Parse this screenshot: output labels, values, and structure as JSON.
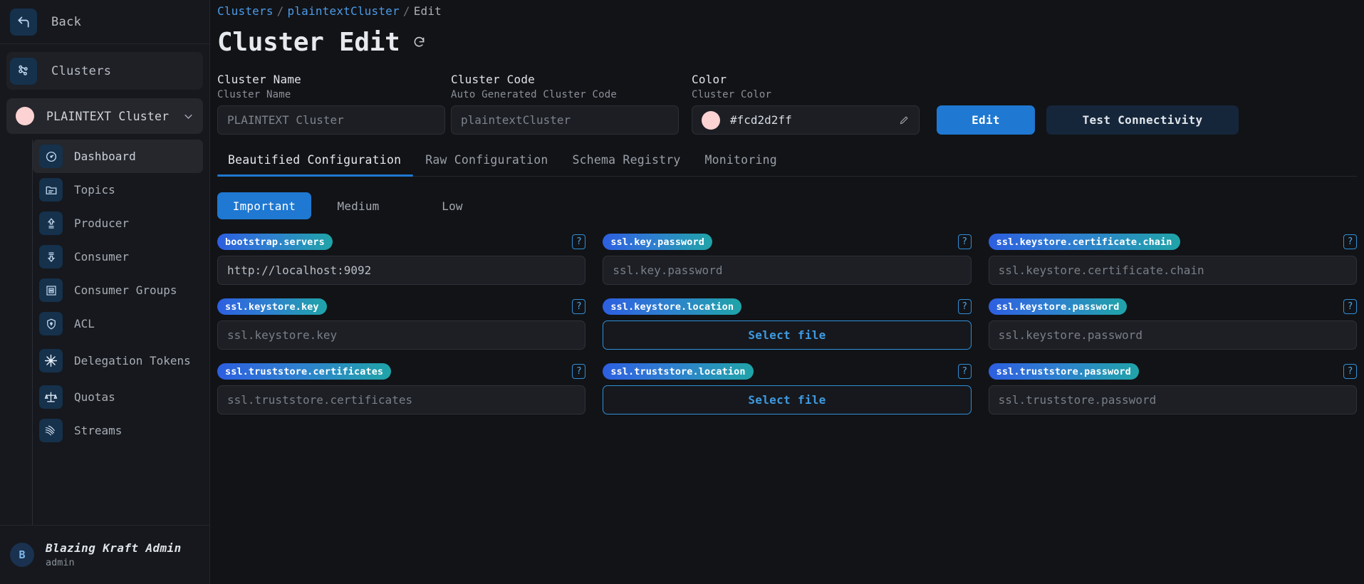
{
  "sidebar": {
    "back_label": "Back",
    "clusters_label": "Clusters",
    "selected_cluster": "PLAINTEXT Cluster",
    "selected_cluster_color": "#fcd2d2",
    "nav": [
      {
        "label": "Dashboard",
        "icon": "gauge-icon",
        "active": true
      },
      {
        "label": "Topics",
        "icon": "folder-icon",
        "active": false
      },
      {
        "label": "Producer",
        "icon": "upload-arrow-icon",
        "active": false
      },
      {
        "label": "Consumer",
        "icon": "download-arrow-icon",
        "active": false
      },
      {
        "label": "Consumer Groups",
        "icon": "group-list-icon",
        "active": false
      },
      {
        "label": "ACL",
        "icon": "shield-lock-icon",
        "active": false
      },
      {
        "label": "Delegation Tokens",
        "icon": "snowflake-icon",
        "active": false
      },
      {
        "label": "Quotas",
        "icon": "scales-icon",
        "active": false
      },
      {
        "label": "Streams",
        "icon": "streams-icon",
        "active": false
      }
    ],
    "user": {
      "initial": "B",
      "name": "Blazing Kraft Admin",
      "role": "admin"
    }
  },
  "breadcrumb": {
    "root": "Clusters",
    "cluster": "plaintextCluster",
    "current": "Edit",
    "separator": "/"
  },
  "header": {
    "title": "Cluster Edit",
    "refresh_icon": "refresh-icon"
  },
  "form": {
    "cluster_name": {
      "title": "Cluster Name",
      "subtitle": "Cluster Name",
      "placeholder": "PLAINTEXT Cluster",
      "value": ""
    },
    "cluster_code": {
      "title": "Cluster Code",
      "subtitle": "Auto Generated Cluster Code",
      "placeholder": "plaintextCluster",
      "value": ""
    },
    "color": {
      "title": "Color",
      "subtitle": "Cluster Color",
      "value": "#fcd2d2ff",
      "swatch": "#fcd2d2",
      "edit_icon": "pencil-icon"
    },
    "edit_button": "Edit",
    "test_button": "Test Connectivity"
  },
  "tabs": [
    {
      "label": "Beautified Configuration",
      "active": true
    },
    {
      "label": "Raw Configuration",
      "active": false
    },
    {
      "label": "Schema Registry",
      "active": false
    },
    {
      "label": "Monitoring",
      "active": false
    }
  ],
  "importance_filters": [
    {
      "label": "Important",
      "active": true
    },
    {
      "label": "Medium",
      "active": false
    },
    {
      "label": "Low",
      "active": false
    }
  ],
  "config_fields": [
    {
      "name": "bootstrap.servers",
      "kind": "text",
      "value": "http://localhost:9092",
      "placeholder": "",
      "help": "?"
    },
    {
      "name": "ssl.key.password",
      "kind": "text",
      "value": "",
      "placeholder": "ssl.key.password",
      "help": "?"
    },
    {
      "name": "ssl.keystore.certificate.chain",
      "kind": "text",
      "value": "",
      "placeholder": "ssl.keystore.certificate.chain",
      "help": "?"
    },
    {
      "name": "ssl.keystore.key",
      "kind": "text",
      "value": "",
      "placeholder": "ssl.keystore.key",
      "help": "?"
    },
    {
      "name": "ssl.keystore.location",
      "kind": "file",
      "value": "",
      "placeholder": "Select file",
      "help": "?"
    },
    {
      "name": "ssl.keystore.password",
      "kind": "text",
      "value": "",
      "placeholder": "ssl.keystore.password",
      "help": "?"
    },
    {
      "name": "ssl.truststore.certificates",
      "kind": "text",
      "value": "",
      "placeholder": "ssl.truststore.certificates",
      "help": "?"
    },
    {
      "name": "ssl.truststore.location",
      "kind": "file",
      "value": "",
      "placeholder": "Select file",
      "help": "?"
    },
    {
      "name": "ssl.truststore.password",
      "kind": "text",
      "value": "",
      "placeholder": "ssl.truststore.password",
      "help": "?"
    }
  ],
  "colors": {
    "accent": "#1f78d1",
    "link": "#4c9be8",
    "badge_start": "#2d5fe0",
    "badge_end": "#20a4a8",
    "background": "#121317",
    "sidebar_bg": "#16181d"
  }
}
